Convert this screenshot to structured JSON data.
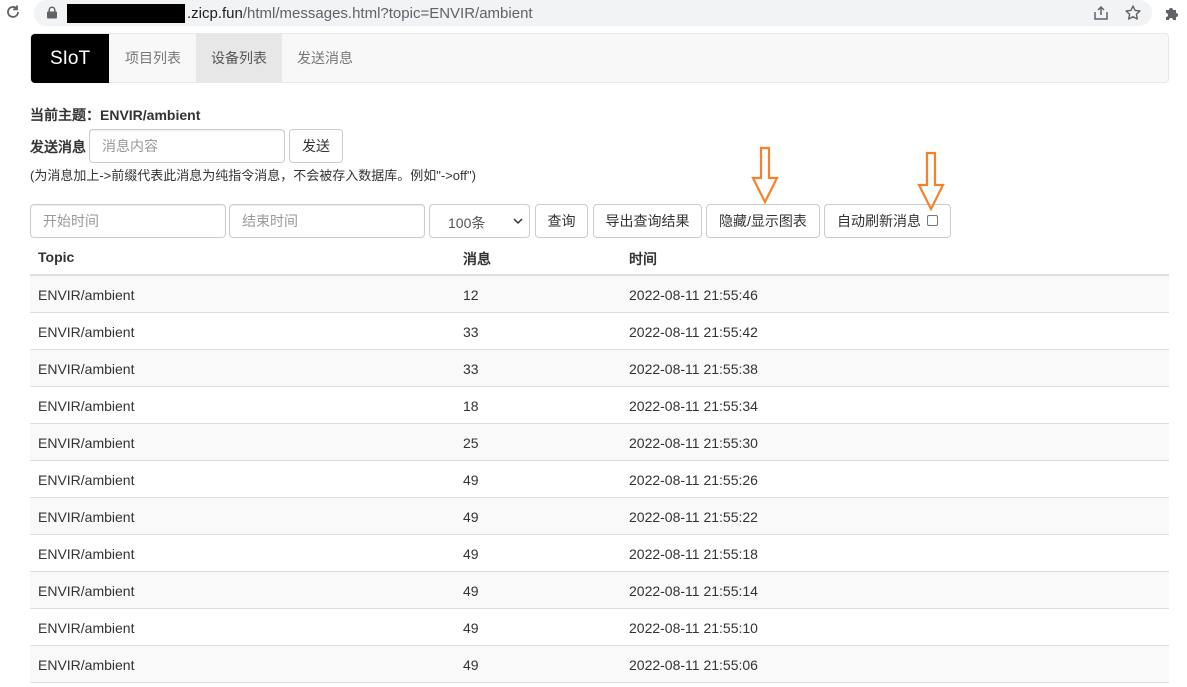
{
  "browser": {
    "url_domain": ".zicp.fun",
    "url_path": "/html/messages.html?topic=ENVIR/ambient",
    "icons": [
      "reload-icon",
      "lock-icon",
      "share-icon",
      "bookmark-star-icon",
      "extensions-puzzle-icon"
    ]
  },
  "navbar": {
    "brand": "SIoT",
    "items": [
      {
        "label": "项目列表",
        "active": false
      },
      {
        "label": "设备列表",
        "active": true
      },
      {
        "label": "发送消息",
        "active": false
      }
    ]
  },
  "topic": {
    "label": "当前主题：",
    "value": "ENVIR/ambient"
  },
  "send": {
    "label": "发送消息",
    "placeholder": "消息内容",
    "button": "发送",
    "hint": "(为消息加上->前缀代表此消息为纯指令消息，不会被存入数据库。例如\"->off\")"
  },
  "query": {
    "start_placeholder": "开始时间",
    "end_placeholder": "结束时间",
    "limit_selected": "100条",
    "query_button": "查询",
    "export_button": "导出查询结果",
    "toggle_chart_button": "隐藏/显示图表",
    "auto_refresh_label": "自动刷新消息",
    "auto_refresh_checked": false
  },
  "colors": {
    "brand_bg": "#000000",
    "annotation_arrow": "#f5822a",
    "stripe": "#f9f9f9"
  },
  "table": {
    "headers": [
      "Topic",
      "消息",
      "时间"
    ],
    "rows": [
      [
        "ENVIR/ambient",
        "12",
        "2022-08-11 21:55:46"
      ],
      [
        "ENVIR/ambient",
        "33",
        "2022-08-11 21:55:42"
      ],
      [
        "ENVIR/ambient",
        "33",
        "2022-08-11 21:55:38"
      ],
      [
        "ENVIR/ambient",
        "18",
        "2022-08-11 21:55:34"
      ],
      [
        "ENVIR/ambient",
        "25",
        "2022-08-11 21:55:30"
      ],
      [
        "ENVIR/ambient",
        "49",
        "2022-08-11 21:55:26"
      ],
      [
        "ENVIR/ambient",
        "49",
        "2022-08-11 21:55:22"
      ],
      [
        "ENVIR/ambient",
        "49",
        "2022-08-11 21:55:18"
      ],
      [
        "ENVIR/ambient",
        "49",
        "2022-08-11 21:55:14"
      ],
      [
        "ENVIR/ambient",
        "49",
        "2022-08-11 21:55:10"
      ],
      [
        "ENVIR/ambient",
        "49",
        "2022-08-11 21:55:06"
      ]
    ]
  }
}
